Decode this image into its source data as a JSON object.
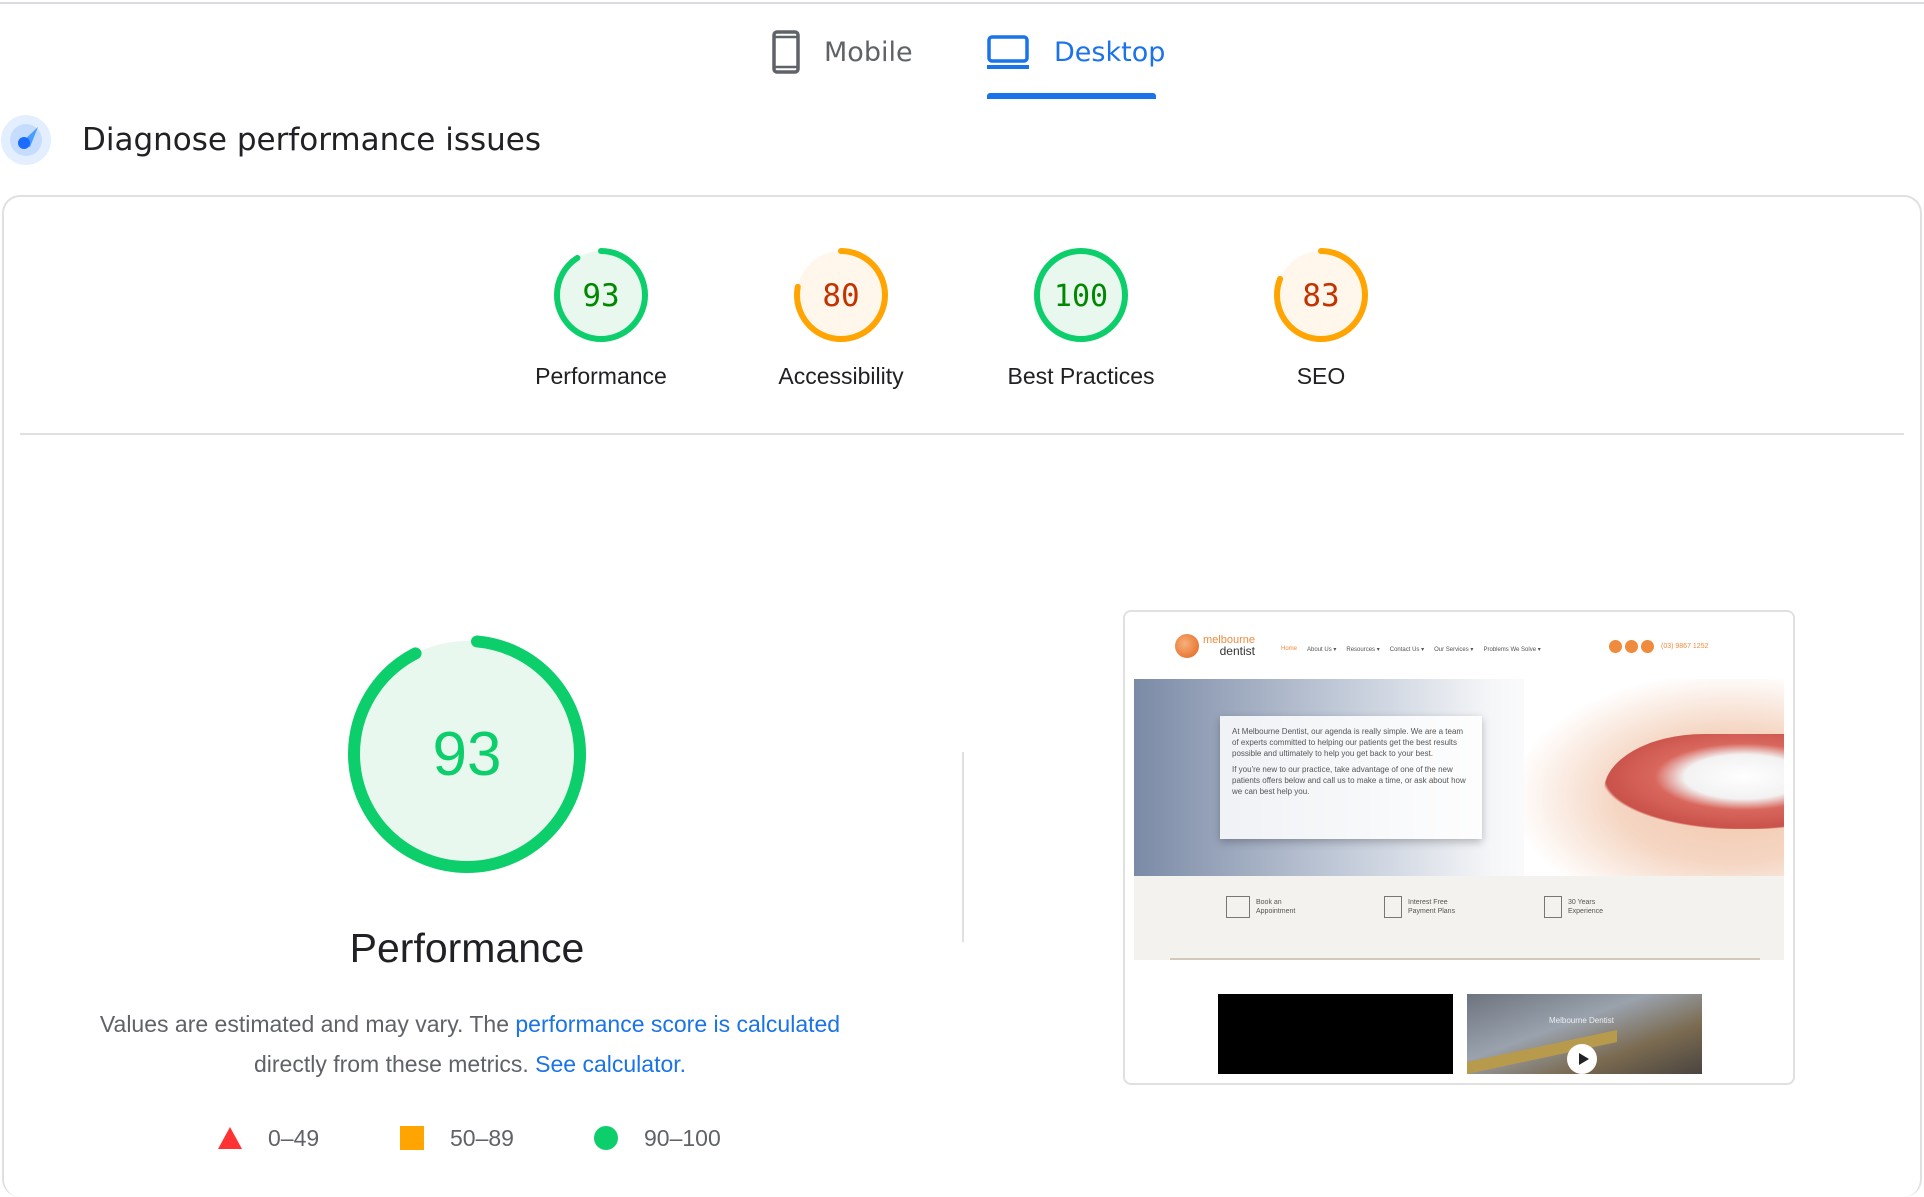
{
  "tabs": [
    {
      "label": "Mobile",
      "icon": "smartphone-icon",
      "active": false
    },
    {
      "label": "Desktop",
      "icon": "laptop-icon",
      "active": true
    }
  ],
  "section": {
    "title": "Diagnose performance issues",
    "icon": "lighthouse-gauge-icon"
  },
  "scores": [
    {
      "label": "Performance",
      "value": 93,
      "rating": "good"
    },
    {
      "label": "Accessibility",
      "value": 80,
      "rating": "average"
    },
    {
      "label": "Best Practices",
      "value": 100,
      "rating": "good"
    },
    {
      "label": "SEO",
      "value": 83,
      "rating": "average"
    }
  ],
  "colors": {
    "good_stroke": "#0cce6b",
    "good_text": "#008800",
    "good_fill": "#e8f8ef",
    "average_stroke": "#ffa400",
    "average_text": "#c33300",
    "average_fill": "#fff6ec",
    "poor": "#ff3333",
    "accent": "#1a73e8",
    "track": "#e8f8ef"
  },
  "detail": {
    "title": "Performance",
    "value": 93,
    "desc_prefix": "Values are estimated and may vary. The ",
    "desc_link1": "performance score is calculated",
    "desc_middle": "directly from these metrics.",
    "desc_link2": "See calculator."
  },
  "legend": [
    {
      "shape": "triangle",
      "range": "0–49",
      "color": "#ff3333"
    },
    {
      "shape": "square",
      "range": "50–89",
      "color": "#ffa400"
    },
    {
      "shape": "circle",
      "range": "90–100",
      "color": "#0cce6b"
    }
  ],
  "screenshot": {
    "logo_line1": "melbourne",
    "logo_line2": "dentist",
    "menu": [
      "Home",
      "About Us  ▾",
      "Resources  ▾",
      "Contact Us  ▾",
      "Our Services  ▾",
      "Problems We Solve  ▾"
    ],
    "phone": "(03) 9867 1252",
    "hero_p1": "At Melbourne Dentist, our agenda is really simple. We are a team of experts committed to helping our patients get the best results possible and ultimately to help you get back to your best.",
    "hero_p2": "If you're new to our practice, take advantage of one of the new patients offers below and call us to make a time, or ask about how we can best help you.",
    "features": [
      {
        "line1": "Book an",
        "line2": "Appointment"
      },
      {
        "line1": "Interest Free",
        "line2": "Payment Plans"
      },
      {
        "line1": "30 Years",
        "line2": "Experience"
      }
    ],
    "video_title": "Melbourne Dentist"
  }
}
